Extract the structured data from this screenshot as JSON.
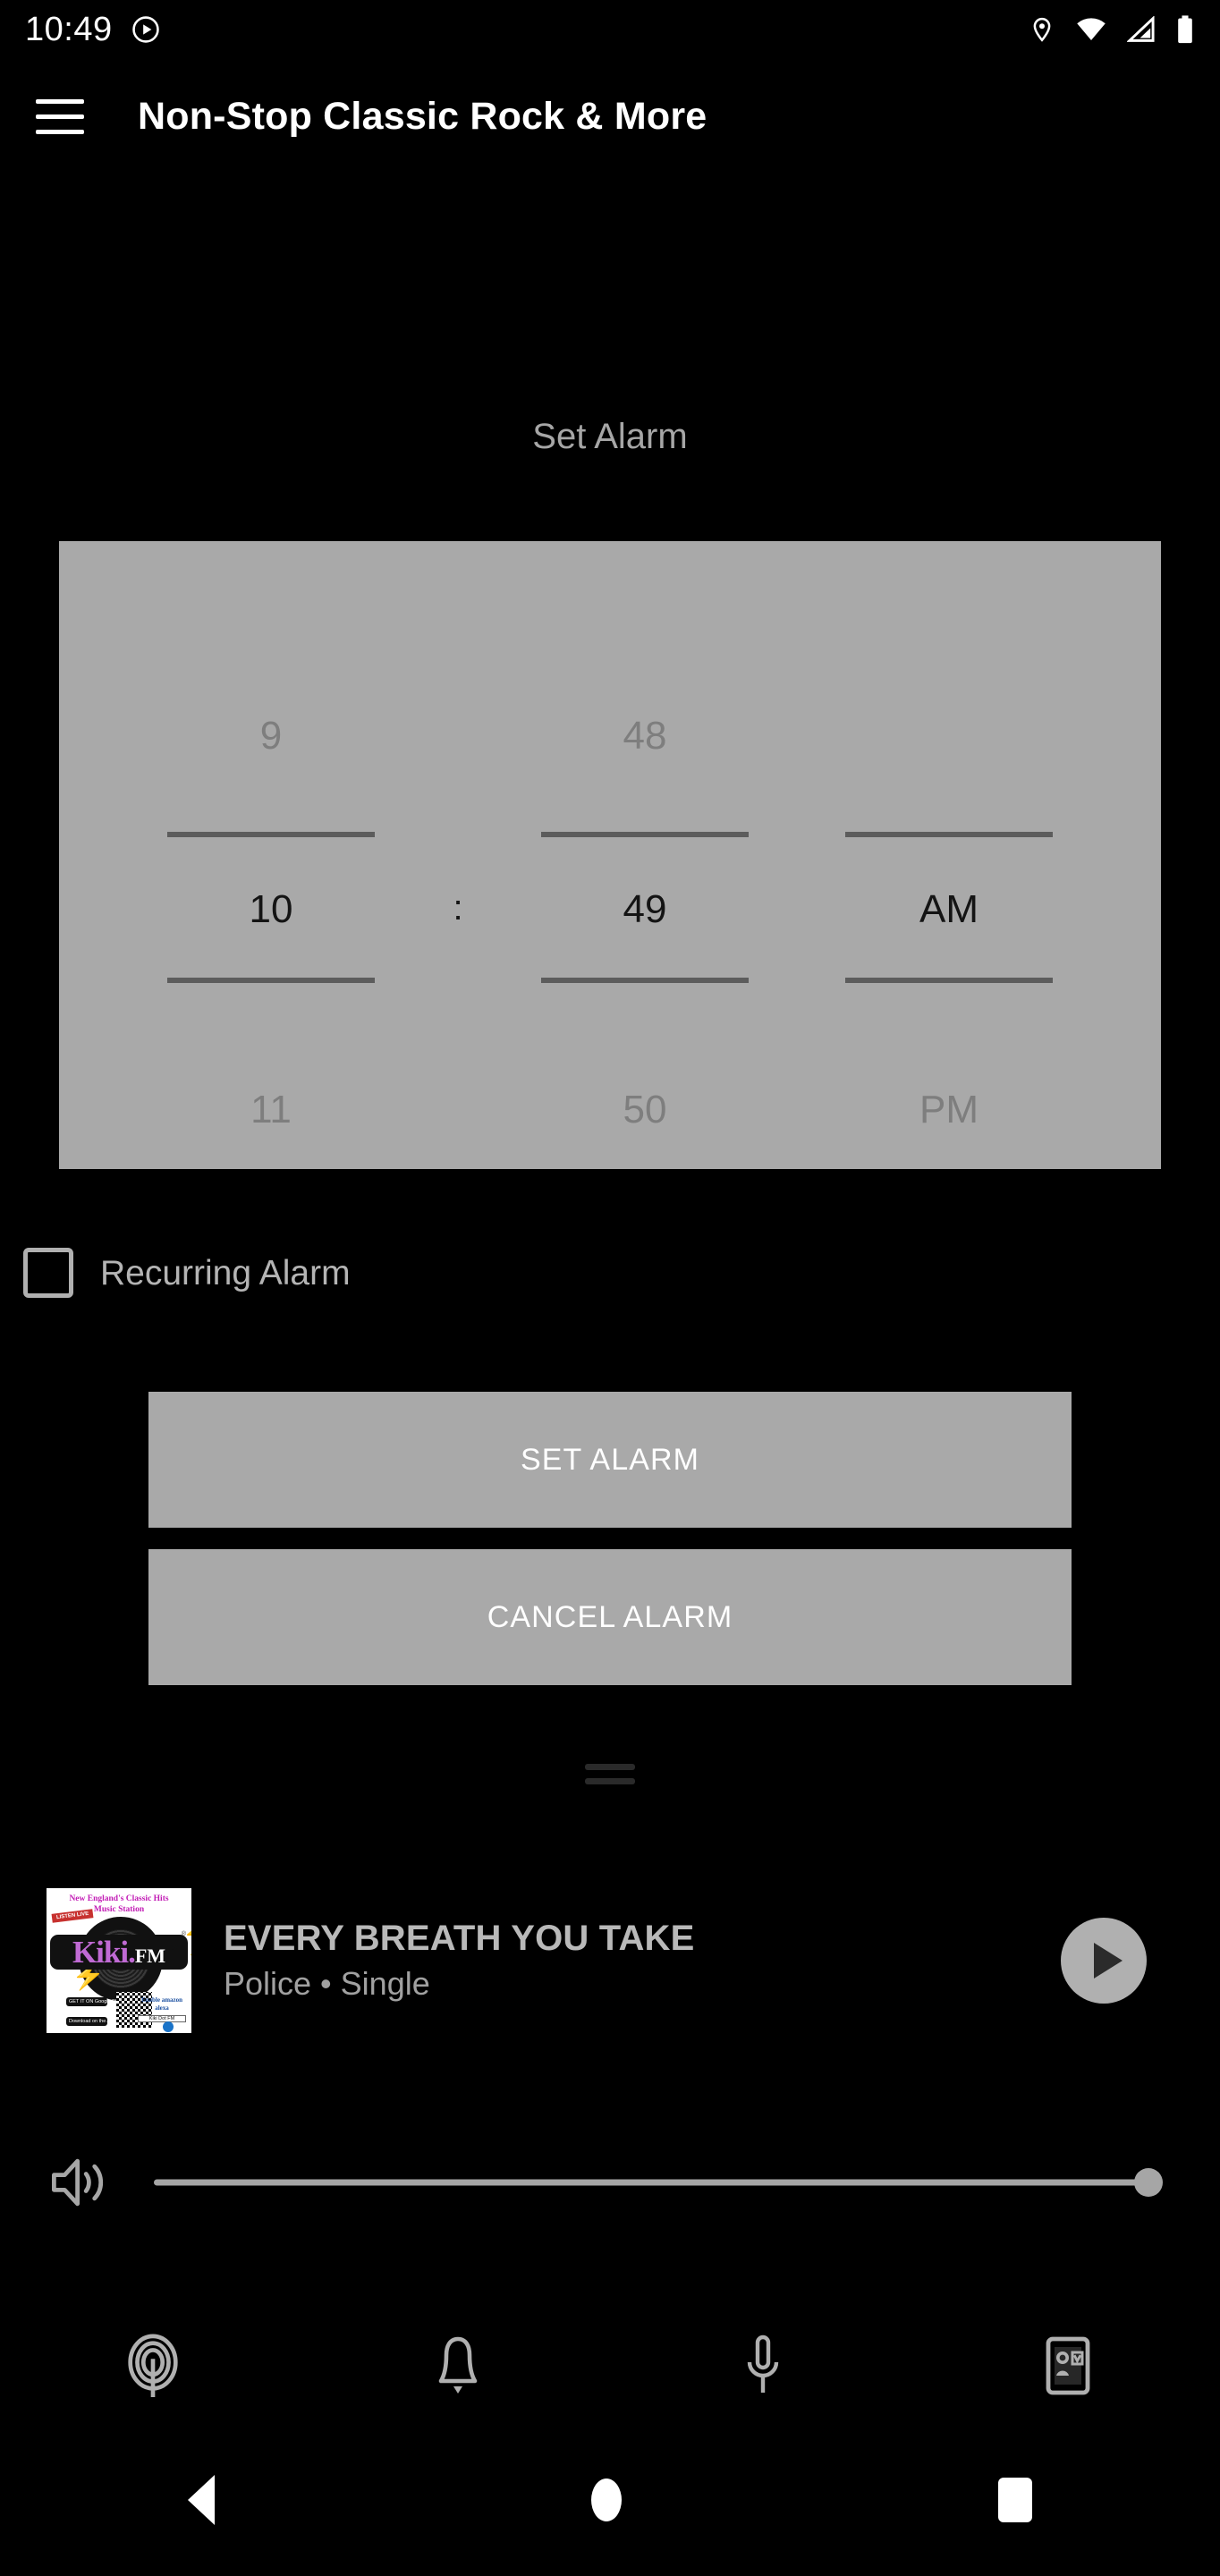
{
  "status_bar": {
    "time": "10:49",
    "icons": [
      "play-circle-icon",
      "location-pin-icon",
      "wifi-icon",
      "cellular-signal-icon",
      "battery-icon"
    ]
  },
  "app_bar": {
    "menu_icon": "hamburger-menu-icon",
    "title": "Non-Stop Classic Rock & More"
  },
  "alarm": {
    "heading": "Set Alarm",
    "time_picker": {
      "hour": {
        "previous": "9",
        "selected": "10",
        "next": "11"
      },
      "separator": ":",
      "minute": {
        "previous": "48",
        "selected": "49",
        "next": "50"
      },
      "meridiem": {
        "previous": "",
        "selected": "AM",
        "next": "PM"
      }
    },
    "recurring": {
      "label": "Recurring Alarm",
      "checked": false
    },
    "set_button": "SET ALARM",
    "cancel_button": "CANCEL ALARM"
  },
  "now_playing": {
    "artwork": {
      "alt": "kiki-fm-station-logo",
      "tagline_line1": "New England's Classic Hits",
      "tagline_line2": "Music Station",
      "wordmark_name": "Kiki.",
      "wordmark_suffix": "FM",
      "live_badge": "LISTEN LIVE",
      "google_play_badge": "GET IT ON Google Play",
      "app_store_badge": "Download on the App Store",
      "alexa_label": "Enable amazon alexa",
      "alexa_sub": "Kiki Dot FM",
      "registered_mark": "®"
    },
    "title": "EVERY BREATH YOU TAKE",
    "subtitle": "Police • Single",
    "play_button": "play-icon"
  },
  "volume": {
    "icon": "volume-up-icon",
    "level": 100
  },
  "tabs": [
    {
      "name": "broadcast-icon",
      "label": ""
    },
    {
      "name": "bell-icon",
      "label": ""
    },
    {
      "name": "microphone-icon",
      "label": ""
    },
    {
      "name": "contact-card-icon",
      "label": ""
    }
  ],
  "system_nav": {
    "back": "back-triangle-icon",
    "home": "home-circle-icon",
    "recents": "recents-square-icon"
  },
  "colors": {
    "background": "#000000",
    "panel_gray": "#a9a9a9",
    "rule_gray": "#5c5c5c",
    "text_gray": "#b4b4b4",
    "selected_text": "#141414",
    "ghost_text": "#7e7e7e",
    "brand_purple": "#c06ad4"
  }
}
